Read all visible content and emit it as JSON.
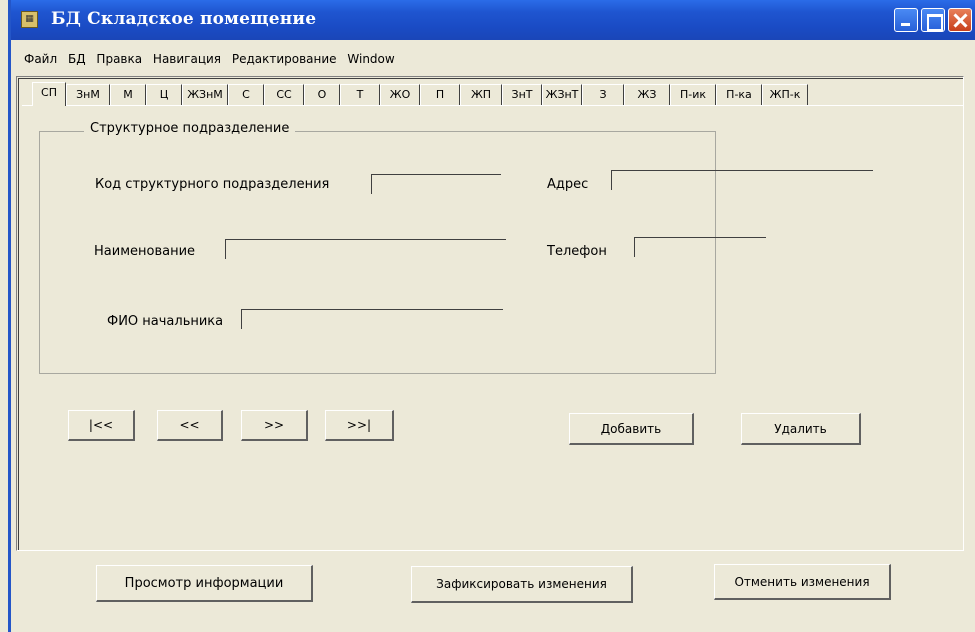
{
  "window": {
    "title": "БД Складское помещение",
    "icon": "app-icon"
  },
  "menu": [
    "Файл",
    "БД",
    "Правка",
    "Навигация",
    "Редактирование",
    "Window"
  ],
  "tabs": [
    "СП",
    "ЗнМ",
    "М",
    "Ц",
    "ЖЗнМ",
    "С",
    "СС",
    "О",
    "Т",
    "ЖО",
    "П",
    "ЖП",
    "ЗнТ",
    "ЖЗнТ",
    "З",
    "ЖЗ",
    "П-ик",
    "П-ка",
    "ЖП-к"
  ],
  "active_tab": "СП",
  "form": {
    "group_title": "Структурное подразделение",
    "code_label": "Код структурного подразделения",
    "code_value": "",
    "name_label": "Наименование",
    "name_value": "",
    "head_label": "ФИО начальника",
    "head_value": "",
    "address_label": "Адрес",
    "address_value": "",
    "phone_label": "Телефон",
    "phone_value": ""
  },
  "nav": {
    "first": "|<<",
    "prev": "<<",
    "next": ">>",
    "last": ">>|"
  },
  "actions": {
    "add": "Добавить",
    "delete": "Удалить"
  },
  "bottom": {
    "view": "Просмотр информации",
    "commit": "Зафиксировать изменения",
    "cancel": "Отменить изменения"
  }
}
